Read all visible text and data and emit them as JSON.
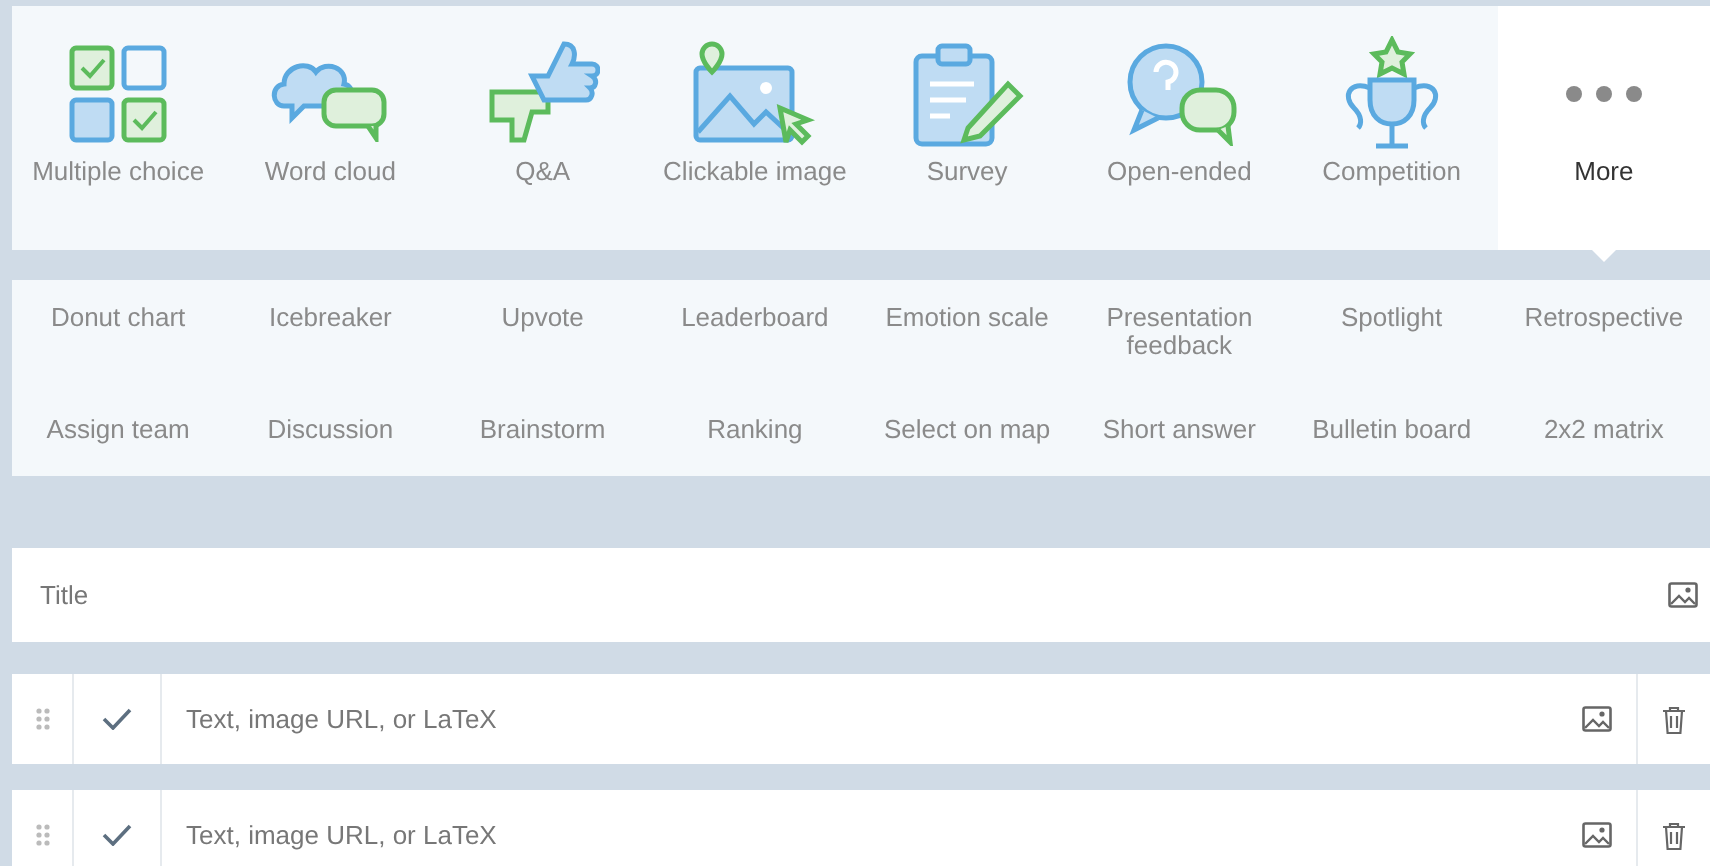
{
  "question_types": [
    {
      "kind": "multiple-choice",
      "label": "Multiple choice",
      "selected": false
    },
    {
      "kind": "word-cloud",
      "label": "Word cloud",
      "selected": false
    },
    {
      "kind": "qa",
      "label": "Q&A",
      "selected": false
    },
    {
      "kind": "clickable-image",
      "label": "Clickable image",
      "selected": false
    },
    {
      "kind": "survey",
      "label": "Survey",
      "selected": false
    },
    {
      "kind": "open-ended",
      "label": "Open-ended",
      "selected": false
    },
    {
      "kind": "competition",
      "label": "Competition",
      "selected": false
    },
    {
      "kind": "more",
      "label": "More",
      "selected": true
    }
  ],
  "more_types": [
    "Donut chart",
    "Icebreaker",
    "Upvote",
    "Leaderboard",
    "Emotion scale",
    "Presentation feedback",
    "Spotlight",
    "Retrospective",
    "Assign team",
    "Discussion",
    "Brainstorm",
    "Ranking",
    "Select on map",
    "Short answer",
    "Bulletin board",
    "2x2 matrix"
  ],
  "title_field": {
    "placeholder": "Title"
  },
  "options": [
    {
      "placeholder": "Text, image URL, or LaTeX",
      "correct": false
    },
    {
      "placeholder": "Text, image URL, or LaTeX",
      "correct": false
    }
  ]
}
